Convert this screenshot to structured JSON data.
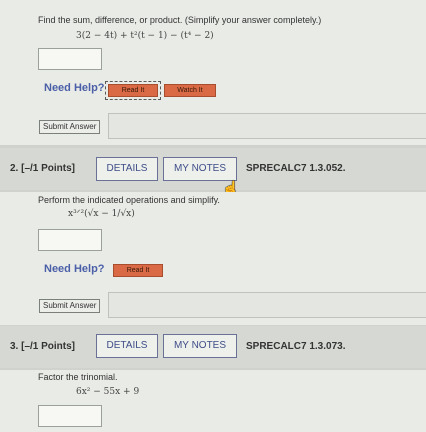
{
  "q1": {
    "prompt": "Find the sum, difference, or product. (Simplify your answer completely.)",
    "expression": "3(2 − 4t) + t²(t − 1) − (t⁴ − 2)",
    "need_help": "Need Help?",
    "read_it": "Read It",
    "watch_it": "Watch It",
    "submit": "Submit Answer"
  },
  "q2": {
    "points": "2.  [–/1 Points]",
    "details": "DETAILS",
    "my_notes": "MY NOTES",
    "code": "SPRECALC7 1.3.052.",
    "prompt": "Perform the indicated operations and simplify.",
    "expression": "x³ᐟ²(√x − 1/√x)",
    "need_help": "Need Help?",
    "read_it": "Read It",
    "submit": "Submit Answer"
  },
  "q3": {
    "points": "3.  [–/1 Points]",
    "details": "DETAILS",
    "my_notes": "MY NOTES",
    "code": "SPRECALC7 1.3.073.",
    "prompt": "Factor the trinomial.",
    "expression": "6x² − 55x + 9"
  }
}
